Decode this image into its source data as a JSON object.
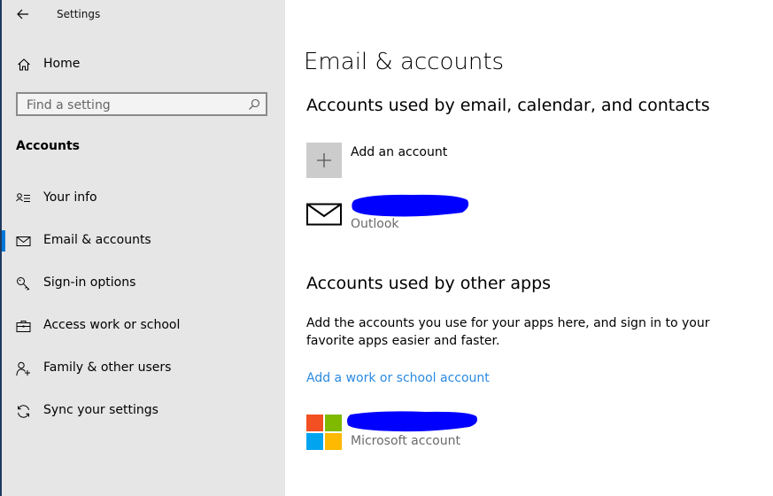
{
  "app": {
    "title": "Settings"
  },
  "sidebar": {
    "home_label": "Home",
    "search_placeholder": "Find a setting",
    "section_heading": "Accounts",
    "items": [
      {
        "label": "Your info",
        "icon": "contact-info-icon"
      },
      {
        "label": "Email & accounts",
        "icon": "mail-icon",
        "selected": true
      },
      {
        "label": "Sign-in options",
        "icon": "key-icon"
      },
      {
        "label": "Access work or school",
        "icon": "briefcase-icon"
      },
      {
        "label": "Family & other users",
        "icon": "person-add-icon"
      },
      {
        "label": "Sync your settings",
        "icon": "sync-icon"
      }
    ]
  },
  "main": {
    "title": "Email & accounts",
    "email_section": {
      "heading": "Accounts used by email, calendar, and contacts",
      "add_account_label": "Add an account",
      "accounts": [
        {
          "type_label": "Outlook",
          "icon": "mail-icon"
        }
      ]
    },
    "apps_section": {
      "heading": "Accounts used by other apps",
      "description": "Add the accounts you use for your apps here, and sign in to your favorite apps easier and faster.",
      "add_work_link": "Add a work or school account",
      "accounts": [
        {
          "type_label": "Microsoft account",
          "icon": "microsoft-logo-icon"
        }
      ]
    }
  },
  "colors": {
    "accent": "#0078d7",
    "link": "#2a8ae0",
    "sidebar_bg": "#e6e6e6",
    "redaction": "#0000ff",
    "ms_red": "#f25022",
    "ms_green": "#7fba00",
    "ms_blue": "#00a4ef",
    "ms_yellow": "#ffb900"
  }
}
